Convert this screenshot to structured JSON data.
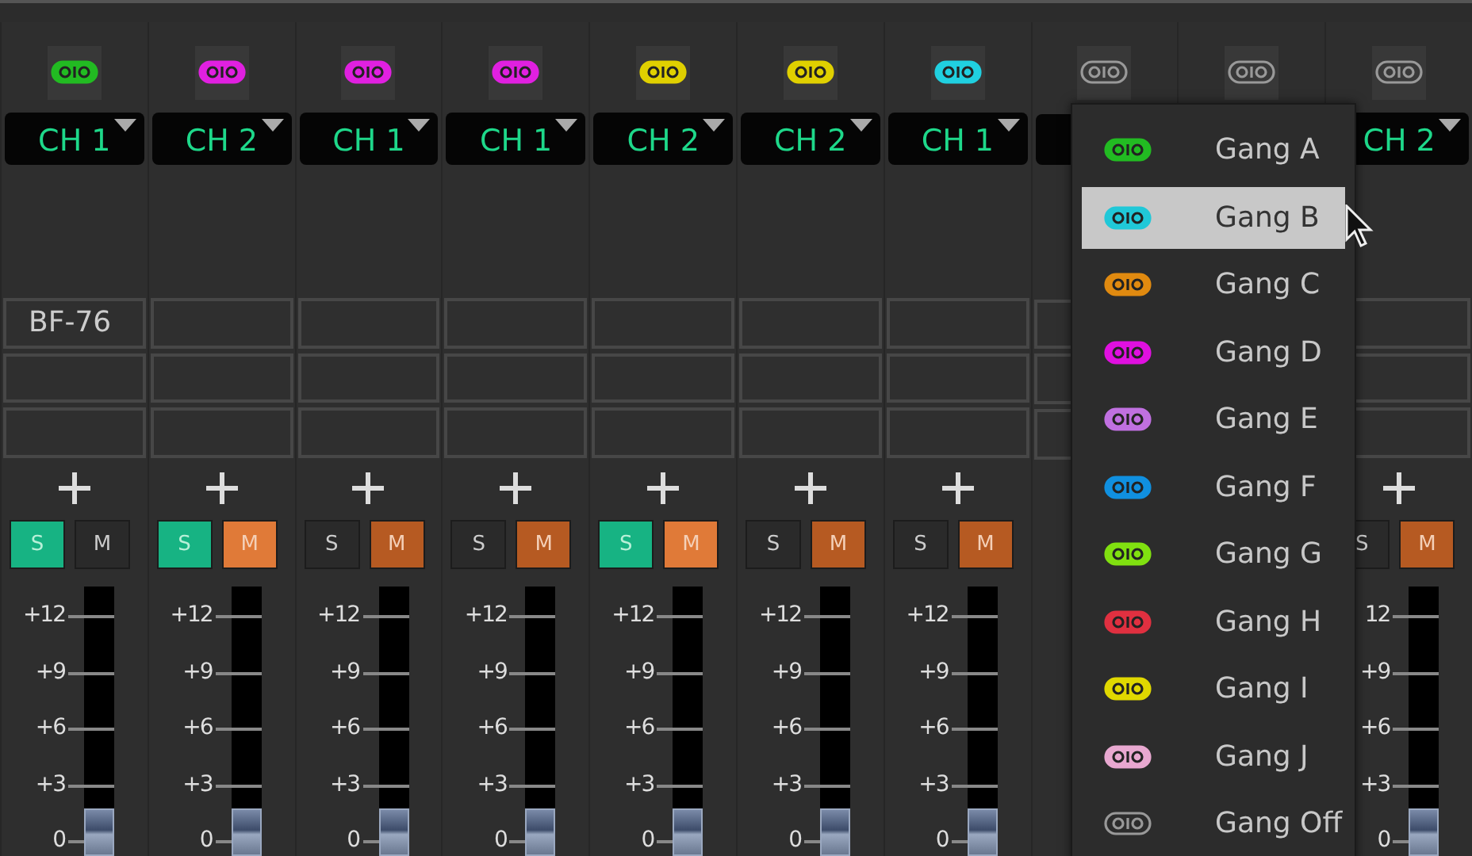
{
  "strips": [
    {
      "ganged": true,
      "color": "#22bb22",
      "channel": "CH 1",
      "inserts": [
        "BF-76"
      ],
      "solo_label": "S",
      "solo": true,
      "mute_label": "M",
      "mute": false,
      "scale": [
        "+12",
        "+9",
        "+6",
        "+3",
        "0"
      ],
      "level": 0.09
    },
    {
      "ganged": true,
      "color": "#e020e0",
      "channel": "CH 2",
      "solo_label": "S",
      "solo": true,
      "mute_label": "M",
      "mute": true,
      "scale": [
        "+12",
        "+9",
        "+6",
        "+3",
        "0"
      ],
      "level": 0.09
    },
    {
      "ganged": true,
      "color": "#e020e0",
      "channel": "CH 1",
      "solo_label": "S",
      "solo": false,
      "mute_label": "M",
      "mute": true,
      "scale": [
        "+12",
        "+9",
        "+6",
        "+3",
        "0"
      ],
      "level": 0.09
    },
    {
      "ganged": true,
      "color": "#e020e0",
      "channel": "CH 1",
      "solo_label": "S",
      "solo": false,
      "mute_label": "M",
      "mute": true,
      "scale": [
        "+12",
        "+9",
        "+6",
        "+3",
        "0"
      ],
      "level": 0.09
    },
    {
      "ganged": true,
      "color": "#e0d000",
      "channel": "CH 2",
      "solo_label": "S",
      "solo": true,
      "mute_label": "M",
      "mute": true,
      "scale": [
        "+12",
        "+9",
        "+6",
        "+3",
        "0"
      ],
      "level": 0.09
    },
    {
      "ganged": true,
      "color": "#e0d000",
      "channel": "CH 2",
      "solo_label": "S",
      "solo": false,
      "mute_label": "M",
      "mute": true,
      "scale": [
        "+12",
        "+9",
        "+6",
        "+3",
        "0"
      ],
      "level": 0.09
    },
    {
      "ganged": true,
      "color": "#20d0e0",
      "channel": "CH 1",
      "solo_label": "S",
      "solo": false,
      "mute_label": "M",
      "mute": true,
      "scale": [
        "+12",
        "+9",
        "+6",
        "+3",
        "0"
      ],
      "level": 0.09
    },
    {
      "ganged": false
    },
    {
      "ganged": false
    },
    {
      "ganged": false,
      "channel": "CH 2",
      "solo_label": "S",
      "solo": false,
      "mute_label": "M",
      "mute": true,
      "scale": [
        "12",
        "+9",
        "+6",
        "+3",
        "0"
      ],
      "level": 0.09
    }
  ],
  "gang_menu": {
    "items": [
      {
        "label": "Gang A",
        "color": "#22bb22",
        "selected": false
      },
      {
        "label": "Gang B",
        "color": "#20c8d8",
        "selected": true
      },
      {
        "label": "Gang C",
        "color": "#e08a10",
        "selected": false
      },
      {
        "label": "Gang D",
        "color": "#e010e0",
        "selected": false
      },
      {
        "label": "Gang E",
        "color": "#c070e0",
        "selected": false
      },
      {
        "label": "Gang F",
        "color": "#1090e0",
        "selected": false
      },
      {
        "label": "Gang G",
        "color": "#80e010",
        "selected": false
      },
      {
        "label": "Gang H",
        "color": "#e03040",
        "selected": false
      },
      {
        "label": "Gang I",
        "color": "#e0d800",
        "selected": false
      },
      {
        "label": "Gang J",
        "color": "#e8a8d0",
        "selected": false
      },
      {
        "label": "Gang Off",
        "selected": false
      }
    ]
  }
}
